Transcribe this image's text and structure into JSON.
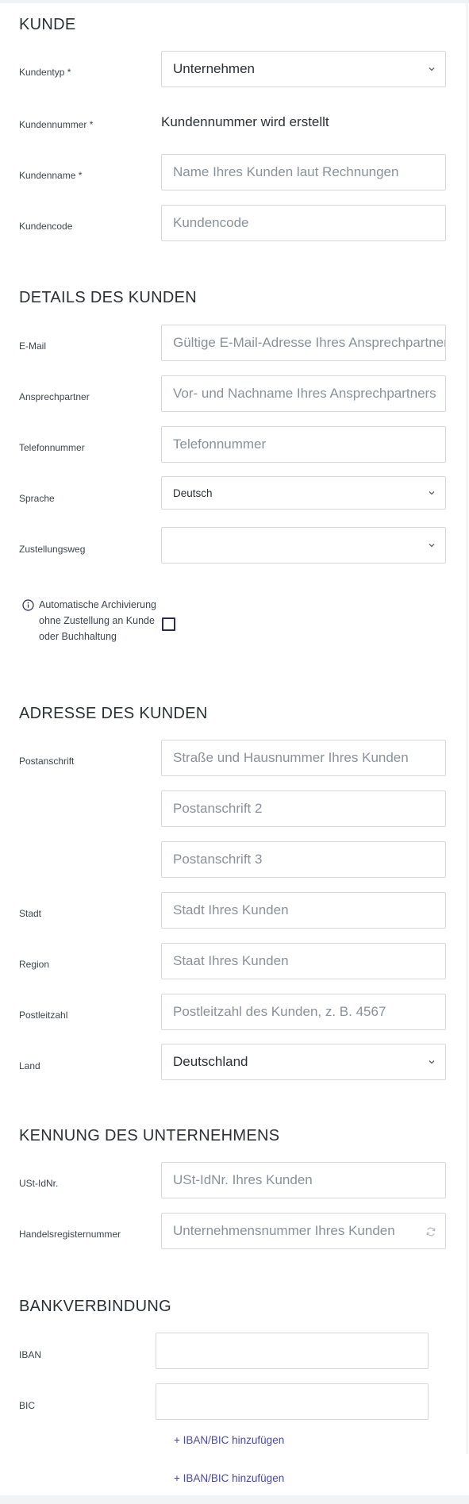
{
  "sections": {
    "kunde": "KUNDE",
    "details": "DETAILS DES KUNDEN",
    "adresse": "ADRESSE DES KUNDEN",
    "kennung": "KENNUNG DES UNTERNEHMENS",
    "bank": "BANKVERBINDUNG"
  },
  "kunde": {
    "kundentyp_label": "Kundentyp *",
    "kundentyp_value": "Unternehmen",
    "kundennummer_label": "Kundennummer *",
    "kundennummer_value": "Kundennummer wird erstellt",
    "kundenname_label": "Kundenname *",
    "kundenname_placeholder": "Name Ihres Kunden laut Rechnungen",
    "kundencode_label": "Kundencode",
    "kundencode_placeholder": "Kundencode"
  },
  "details": {
    "email_label": "E-Mail",
    "email_placeholder": "Gültige E-Mail-Adresse Ihres Ansprechpartner",
    "ansprechpartner_label": "Ansprechpartner",
    "ansprechpartner_placeholder": "Vor- und Nachname Ihres Ansprechpartners",
    "telefon_label": "Telefonnummer",
    "telefon_placeholder": "Telefonnummer",
    "sprache_label": "Sprache",
    "sprache_value": "Deutsch",
    "zustellung_label": "Zustellungsweg",
    "zustellung_value": "",
    "archiv_text": "Automatische Archivierung ohne Zustellung an Kunde oder Buchhaltung",
    "archiv_checked": false
  },
  "adresse": {
    "postanschrift_label": "Postanschrift",
    "postanschrift1_placeholder": "Straße und Hausnummer Ihres Kunden",
    "postanschrift2_placeholder": "Postanschrift 2",
    "postanschrift3_placeholder": "Postanschrift 3",
    "stadt_label": "Stadt",
    "stadt_placeholder": "Stadt Ihres Kunden",
    "region_label": "Region",
    "region_placeholder": "Staat Ihres Kunden",
    "plz_label": "Postleitzahl",
    "plz_placeholder": "Postleitzahl des Kunden, z. B. 4567",
    "land_label": "Land",
    "land_value": "Deutschland"
  },
  "kennung": {
    "ust_label": "USt-IdNr.",
    "ust_placeholder": "USt-IdNr. Ihres Kunden",
    "hr_label": "Handelsregisternummer",
    "hr_placeholder": "Unternehmensnummer Ihres Kunden"
  },
  "bank": {
    "iban_label": "IBAN",
    "iban_value": "",
    "bic_label": "BIC",
    "bic_value": "",
    "add_link": "+ IBAN/BIC hinzufügen"
  },
  "footer": {
    "add_link": "+ IBAN/BIC hinzufügen"
  },
  "colors": {
    "link": "#4a4aa3",
    "checkbox_border": "#2a2a57",
    "input_border": "#d5d9de"
  }
}
